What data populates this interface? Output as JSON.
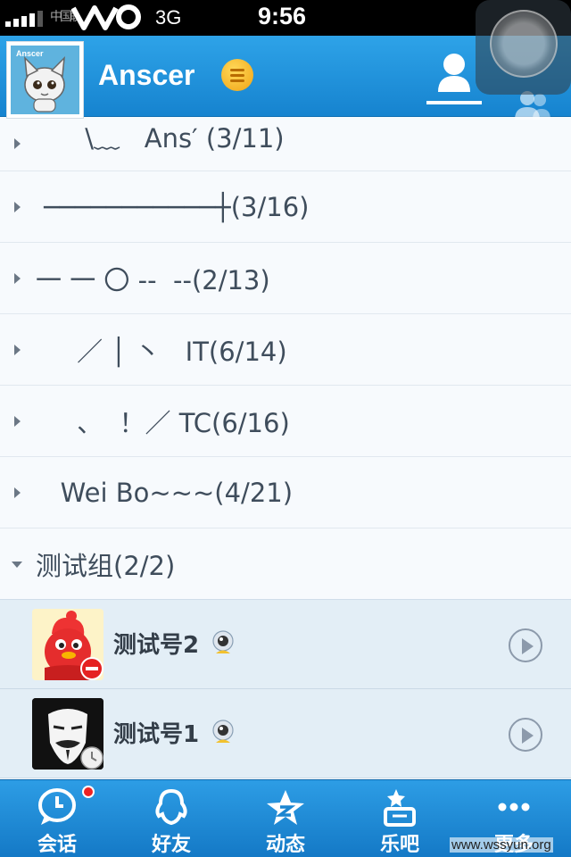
{
  "status_bar": {
    "carrier": "中国联通",
    "network": "3G",
    "time": "9:56"
  },
  "header": {
    "avatar_tag": "Anscer",
    "username": "Anscer",
    "status_icon": "online-status-icon",
    "tabs": [
      "contacts-tab-icon",
      "groups-tab-icon"
    ]
  },
  "groups": [
    {
      "label": "      \\﹏   Ans′ (3/11)",
      "expanded": false
    },
    {
      "label": " ───────────┼(3/16)",
      "expanded": false
    },
    {
      "label": "一 一 〇 --  --(2/13)",
      "expanded": false
    },
    {
      "label": "     ／ │ 丶   IT(6/14)",
      "expanded": false
    },
    {
      "label": "     、  ！／ TC(6/16)",
      "expanded": false
    },
    {
      "label": "   Wei Bo~~~(4/21)",
      "expanded": false
    },
    {
      "label": "测试组(2/2)",
      "expanded": true
    }
  ],
  "friends": [
    {
      "name": "测试号2",
      "status": "busy"
    },
    {
      "name": "测试号1",
      "status": "away"
    }
  ],
  "tabbar": {
    "items": [
      {
        "label": "会话",
        "icon": "chat-icon",
        "badge": true
      },
      {
        "label": "好友",
        "icon": "friends-icon",
        "badge": false
      },
      {
        "label": "动态",
        "icon": "qzone-star-icon",
        "badge": false
      },
      {
        "label": "乐吧",
        "icon": "leba-icon",
        "badge": false
      },
      {
        "label": "更多",
        "icon": "more-icon",
        "badge": false
      }
    ]
  },
  "watermark": "www.wssyun.org",
  "colors": {
    "header": "#1e8fda",
    "tabbar": "#1a87d2",
    "badge": "#e22222"
  }
}
